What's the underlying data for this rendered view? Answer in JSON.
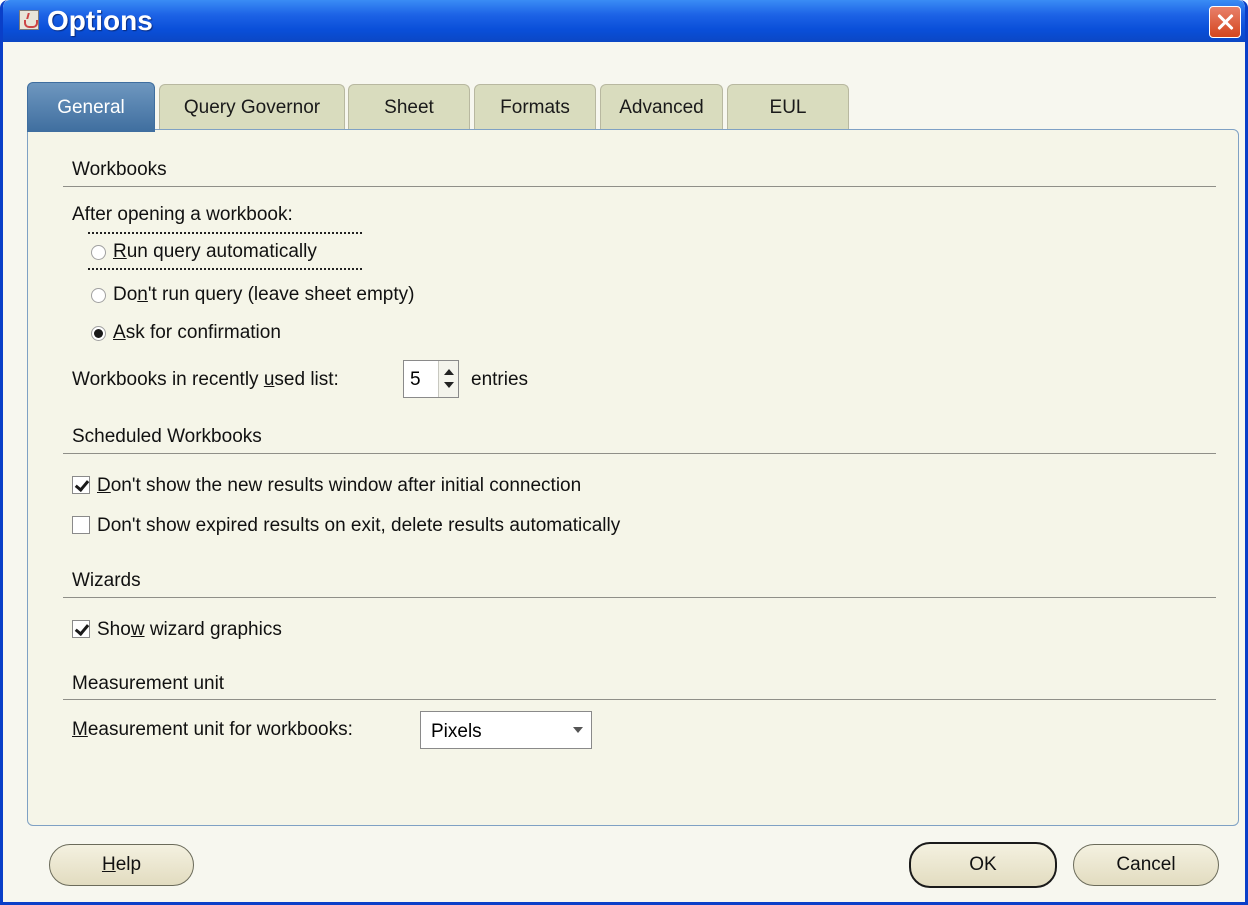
{
  "window": {
    "title": "Options"
  },
  "tabs": [
    {
      "label": "General",
      "active": true
    },
    {
      "label": "Query Governor",
      "active": false
    },
    {
      "label": "Sheet",
      "active": false
    },
    {
      "label": "Formats",
      "active": false
    },
    {
      "label": "Advanced",
      "active": false
    },
    {
      "label": "EUL",
      "active": false
    }
  ],
  "workbooks": {
    "section_title": "Workbooks",
    "after_opening_label": "After opening a workbook:",
    "options": [
      {
        "pre": "",
        "mnemonic": "R",
        "post": "un query automatically",
        "selected": false
      },
      {
        "pre": "Do",
        "mnemonic": "n",
        "post": "'t run query (leave sheet empty)",
        "selected": false
      },
      {
        "pre": "",
        "mnemonic": "A",
        "post": "sk for confirmation",
        "selected": true
      }
    ],
    "recent_list": {
      "pre": "Workbooks in recently ",
      "mnemonic": "u",
      "post": "sed list:",
      "value": "5",
      "suffix": "entries"
    }
  },
  "scheduled": {
    "section_title": "Scheduled Workbooks",
    "options": [
      {
        "pre": "",
        "mnemonic": "D",
        "post": "on't show the new results window after initial connection",
        "checked": true
      },
      {
        "pre": "Don't show expired results on exit, delete results automatically",
        "mnemonic": "",
        "post": "",
        "checked": false
      }
    ]
  },
  "wizards": {
    "section_title": "Wizards",
    "option": {
      "pre": "Sho",
      "mnemonic": "w",
      "post": " wizard graphics",
      "checked": true
    }
  },
  "measurement": {
    "section_title": "Measurement unit",
    "label": {
      "pre": "",
      "mnemonic": "M",
      "post": "easurement unit for workbooks:"
    },
    "value": "Pixels"
  },
  "buttons": {
    "help": {
      "mnemonic": "H",
      "rest": "elp"
    },
    "ok": "OK",
    "cancel": "Cancel"
  }
}
